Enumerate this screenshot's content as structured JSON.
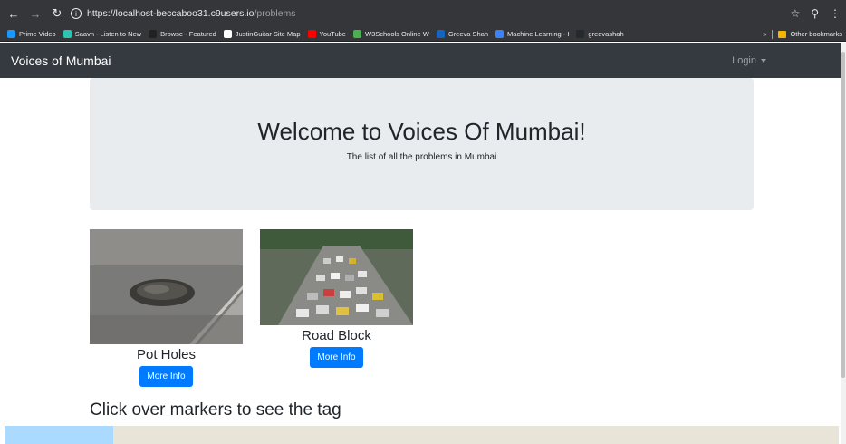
{
  "browser": {
    "url_host": "https://localhost-beccaboo31.c9users.io",
    "url_path": "/problems",
    "bookmarks": [
      {
        "label": "Prime Video",
        "color": "#1a98ff"
      },
      {
        "label": "Saavn - Listen to New",
        "color": "#2bc5b4"
      },
      {
        "label": "Browse - Featured",
        "color": "#222222"
      },
      {
        "label": "JustinGuitar Site Map",
        "color": "#ffffff"
      },
      {
        "label": "YouTube",
        "color": "#ff0000"
      },
      {
        "label": "W3Schools Online W",
        "color": "#4caf50"
      },
      {
        "label": "Greeva Shah",
        "color": "#1565c0"
      },
      {
        "label": "Machine Learning - I",
        "color": "#3b82f6"
      },
      {
        "label": "greevashah",
        "color": "#24292e"
      }
    ],
    "more_label": "»",
    "other_bookmarks": "Other bookmarks"
  },
  "navbar": {
    "brand": "Voices of Mumbai",
    "login": "Login"
  },
  "jumbotron": {
    "title": "Welcome to Voices Of Mumbai!",
    "subtitle": "The list of all the problems in Mumbai"
  },
  "problems": [
    {
      "title": "Pot Holes",
      "button": "More Info"
    },
    {
      "title": "Road Block",
      "button": "More Info"
    }
  ],
  "map_section": {
    "title": "Click over markers to see the tag"
  }
}
